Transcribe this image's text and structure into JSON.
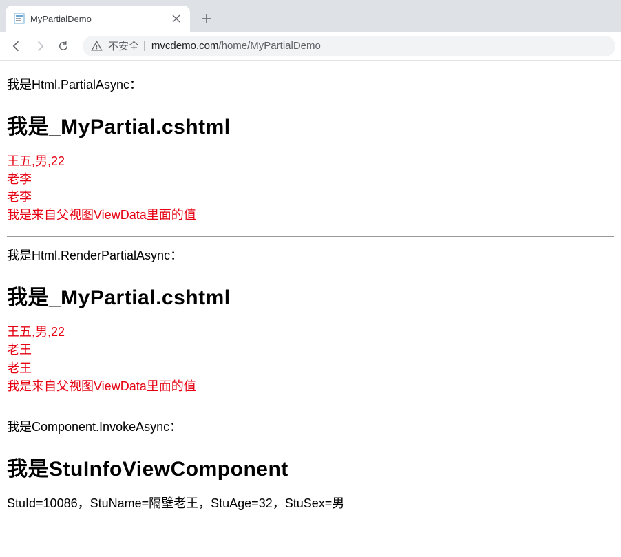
{
  "browser": {
    "tab_title": "MyPartialDemo",
    "security_label": "不安全",
    "url_host": "mvcdemo.com",
    "url_path": "/home/MyPartialDemo"
  },
  "page": {
    "section1": {
      "intro": "我是Html.PartialAsync：",
      "heading": "我是_MyPartial.cshtml",
      "lines": {
        "l1": "王五,男,22",
        "l2": "老李",
        "l3": "老李",
        "l4": "我是来自父视图ViewData里面的值"
      }
    },
    "section2": {
      "intro": "我是Html.RenderPartialAsync：",
      "heading": "我是_MyPartial.cshtml",
      "lines": {
        "l1": "王五,男,22",
        "l2": "老王",
        "l3": "老王",
        "l4": "我是来自父视图ViewData里面的值"
      }
    },
    "section3": {
      "intro": "我是Component.InvokeAsync：",
      "heading": "我是StuInfoViewComponent",
      "detail": "StuId=10086，StuName=隔壁老王，StuAge=32，StuSex=男"
    }
  }
}
